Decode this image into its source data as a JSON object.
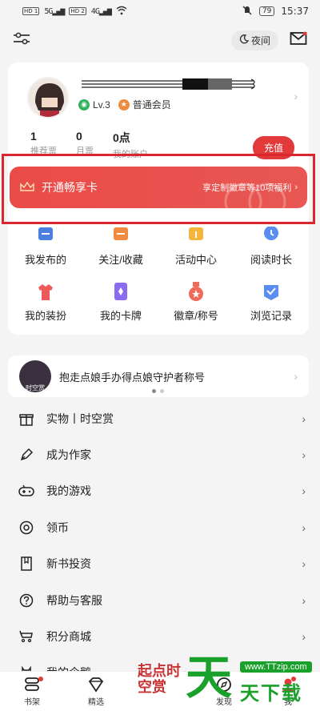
{
  "status": {
    "sim1": "HD 1",
    "sim2": "HD 2",
    "net1": "5G",
    "net2": "4G",
    "battery": "79",
    "time": "15:37"
  },
  "topbar": {
    "night_label": "夜间"
  },
  "profile": {
    "level": "Lv.3",
    "member": "普通会员",
    "stats": [
      {
        "num": "1",
        "label": "推荐票"
      },
      {
        "num": "0",
        "label": "月票"
      },
      {
        "num": "0点",
        "label": "我的账户"
      }
    ],
    "recharge": "充值"
  },
  "vip": {
    "title": "开通畅享卡",
    "desc": "享定制徽章等10项福利"
  },
  "grid": [
    {
      "label": "我发布的",
      "icon": "post-icon",
      "color": "#4a7fe0"
    },
    {
      "label": "关注/收藏",
      "icon": "favorite-icon",
      "color": "#f08a3c"
    },
    {
      "label": "活动中心",
      "icon": "gift-icon",
      "color": "#f5b640"
    },
    {
      "label": "阅读时长",
      "icon": "clock-icon",
      "color": "#5a8df0"
    },
    {
      "label": "我的装扮",
      "icon": "shirt-icon",
      "color": "#ee5a5a"
    },
    {
      "label": "我的卡牌",
      "icon": "card-icon",
      "color": "#8a6cf0"
    },
    {
      "label": "徽章/称号",
      "icon": "medal-icon",
      "color": "#ee6a5a"
    },
    {
      "label": "浏览记录",
      "icon": "history-icon",
      "color": "#5a8df0"
    }
  ],
  "promo": {
    "text": "抱走点娘手办得点娘守护者称号",
    "avatar_text": "时空赏"
  },
  "menu": [
    {
      "label": "实物丨时空赏",
      "icon": "gift-box-icon"
    },
    {
      "label": "成为作家",
      "icon": "pen-icon"
    },
    {
      "label": "我的游戏",
      "icon": "gamepad-icon"
    },
    {
      "label": "领币",
      "icon": "coin-icon"
    },
    {
      "label": "新书投资",
      "icon": "book-icon"
    },
    {
      "label": "帮助与客服",
      "icon": "help-icon"
    },
    {
      "label": "积分商城",
      "icon": "shop-icon"
    },
    {
      "label": "我的企鹅",
      "icon": "penguin-icon"
    }
  ],
  "tabs": [
    {
      "label": "书架",
      "icon": "bookshelf-icon"
    },
    {
      "label": "精选",
      "icon": "diamond-icon"
    },
    {
      "label": "",
      "icon": "center-icon"
    },
    {
      "label": "发现",
      "icon": "compass-icon"
    },
    {
      "label": "我",
      "icon": "me-icon"
    }
  ],
  "watermark": {
    "left_text": "起点时空赏",
    "big_char": "天",
    "url": "www.TTzip.com",
    "small_text": "天下载"
  }
}
